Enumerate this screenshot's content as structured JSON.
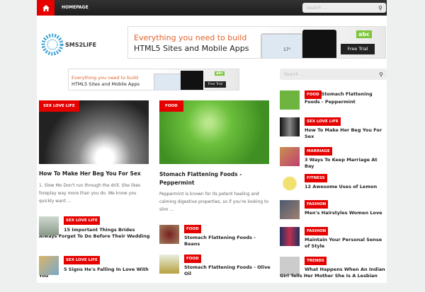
{
  "nav": {
    "homepage": "HOMEPAGE",
    "search_placeholder": "Search ..."
  },
  "logo": {
    "text": "SMS2LIFE"
  },
  "ad": {
    "line1": "Everything you need to build",
    "line2": "HTML5 Sites and Mobile Apps",
    "button": "Free Trial",
    "brand": "abc",
    "temp": "17°"
  },
  "sidebar": {
    "search_placeholder": "Search ...",
    "items": [
      {
        "cat": "FOOD",
        "title": "Stomach Flattening Foods - Peppermint"
      },
      {
        "cat": "SEX LOVE LIFE",
        "title": "How To Make Her Beg You For Sex"
      },
      {
        "cat": "MARRIAGE",
        "title": "3 Ways To Keep Marriage At Bay"
      },
      {
        "cat": "FITNESS",
        "title": "12 Awesome Uses of Lemon"
      },
      {
        "cat": "FASHION",
        "title": "Men's Hairstyles Women Love"
      },
      {
        "cat": "FASHION",
        "title": "Maintain Your Personal Sense of Style"
      },
      {
        "cat": "TRENDS",
        "title": "What Happens When An Indian Girl Tells Her Mother She Is A Lesbian"
      }
    ]
  },
  "col1": {
    "cat": "SEX LOVE LIFE",
    "title": "How To Make Her Beg You For Sex",
    "excerpt": "1. Slow Mo Don't run through the drill. She likes foreplay way more than you do. We know you quickly want ...",
    "items": [
      {
        "cat": "SEX LOVE LIFE",
        "title": "15 Important Things Brides Always Forget To Do Before Their Wedding"
      },
      {
        "cat": "SEX LOVE LIFE",
        "title": "5 Signs He's Falling In Love With You"
      }
    ]
  },
  "col2": {
    "cat": "FOOD",
    "title": "Stomach Flattening Foods - Peppermint",
    "excerpt": "Peppermint is known for its potent healing and calming digestive properties, so if you're looking to slim ...",
    "items": [
      {
        "cat": "FOOD",
        "title": "Stomach Flattening Foods - Beans"
      },
      {
        "cat": "FOOD",
        "title": "Stomach Flattening Foods - Olive Oil"
      }
    ]
  }
}
